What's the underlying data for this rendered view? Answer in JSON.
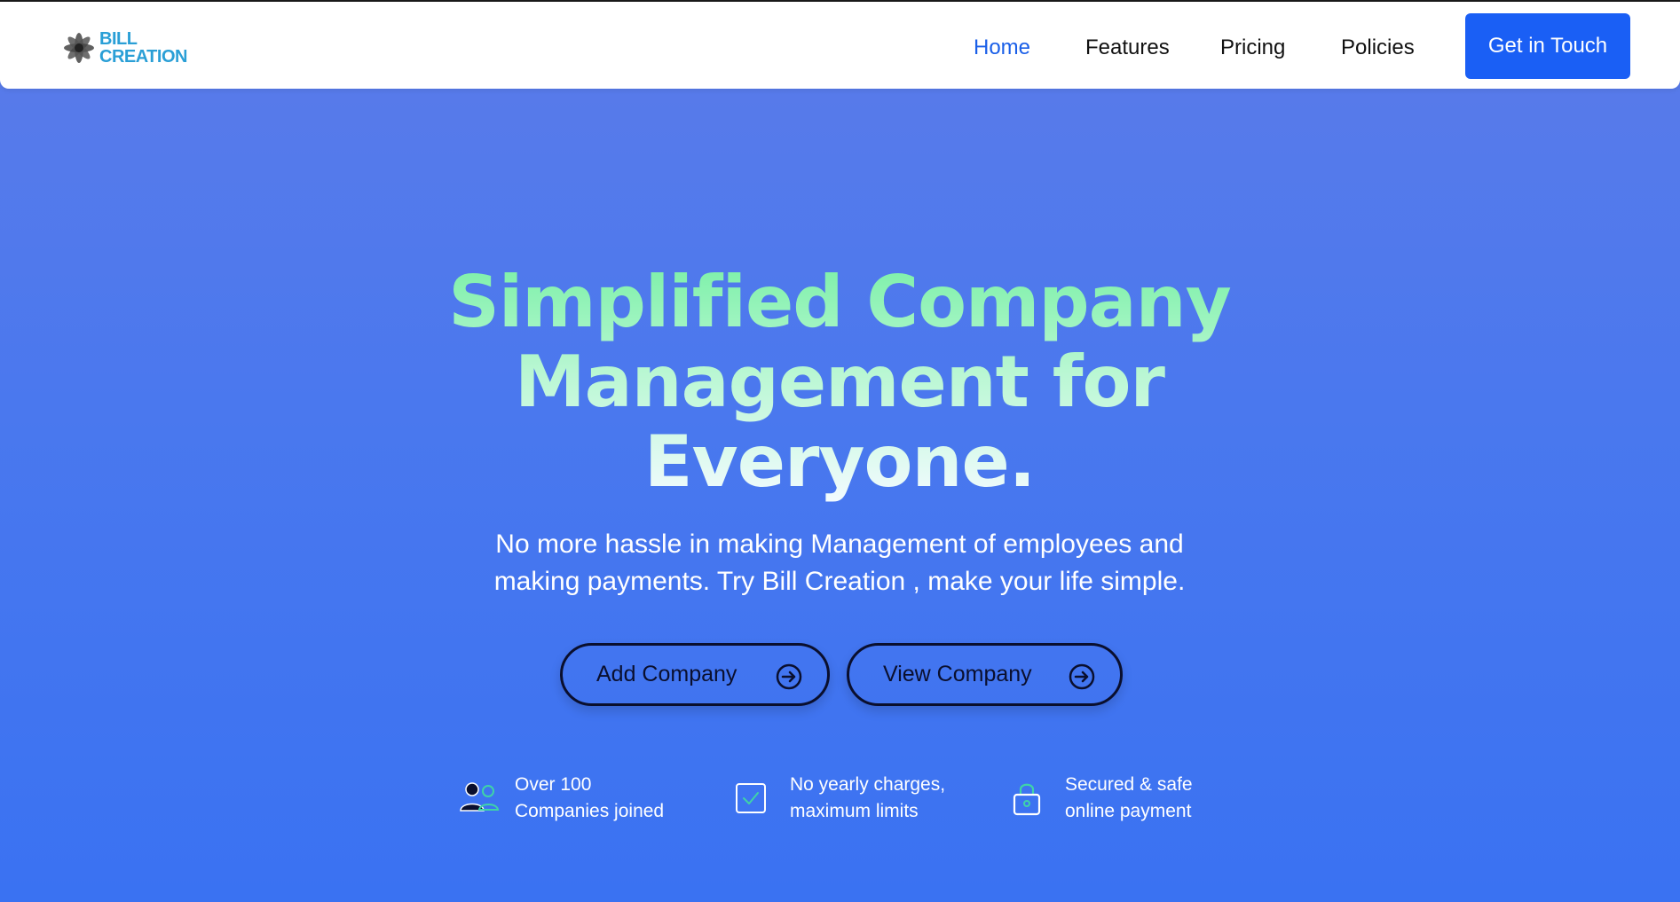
{
  "brand": {
    "line1": "BILL",
    "line2": "CREATION",
    "icon": "flower-icon"
  },
  "nav": {
    "links": [
      {
        "label": "Home",
        "active": true
      },
      {
        "label": "Features",
        "active": false
      },
      {
        "label": "Pricing",
        "active": false
      },
      {
        "label": "Policies",
        "active": false
      }
    ],
    "cta_label": "Get in Touch"
  },
  "hero": {
    "title_line1": "Simplified Company",
    "title_line2": "Management for",
    "title_line3": "Everyone.",
    "subtitle_line1": "No more hassle in making Management of employees and",
    "subtitle_line2": "making payments. Try Bill Creation , make your life simple.",
    "buttons": [
      {
        "label": "Add Company",
        "icon": "arrow-right-circle-icon"
      },
      {
        "label": "View Company",
        "icon": "arrow-right-circle-icon"
      }
    ]
  },
  "features": [
    {
      "icon": "users-icon",
      "line1": "Over 100",
      "line2": "Companies joined"
    },
    {
      "icon": "checkbox-icon",
      "line1": "No yearly charges,",
      "line2": "maximum limits"
    },
    {
      "icon": "lock-icon",
      "line1": "Secured & safe",
      "line2": "online payment"
    }
  ],
  "colors": {
    "primary": "#1a5ff5",
    "nav_active": "#1a5fe8",
    "title_gradient_start": "#7cf0a8",
    "title_gradient_end": "#f2fbff",
    "icon_accent": "#3fd3a8"
  }
}
